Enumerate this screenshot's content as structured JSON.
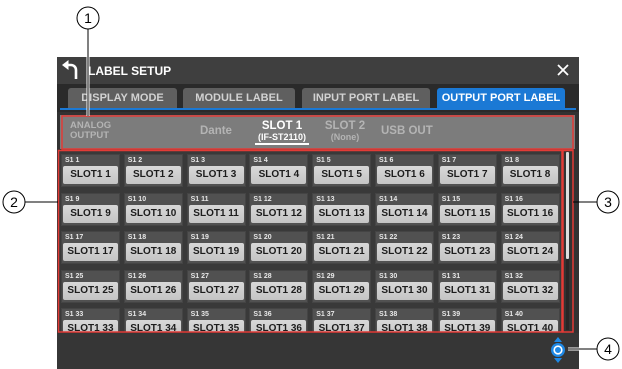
{
  "app": {
    "title": "LABEL SETUP"
  },
  "icons": {
    "back": "back-arrow-icon",
    "close": "close-icon",
    "encoder": "encoder-knob-icon"
  },
  "tabs": [
    {
      "label": "DISPLAY MODE",
      "active": false
    },
    {
      "label": "MODULE LABEL",
      "active": false
    },
    {
      "label": "INPUT PORT LABEL",
      "active": false
    },
    {
      "label": "OUTPUT PORT LABEL",
      "active": true
    }
  ],
  "subtabs": [
    {
      "label": "ANALOG OUTPUT",
      "sub": "",
      "active": false
    },
    {
      "label": "Dante",
      "sub": "",
      "active": false
    },
    {
      "label": "SLOT 1",
      "sub": "(IF-ST2110)",
      "active": true
    },
    {
      "label": "SLOT 2",
      "sub": "(None)",
      "active": false
    },
    {
      "label": "USB OUT",
      "sub": "",
      "active": false
    }
  ],
  "grid": {
    "cells": [
      {
        "port": "S1 1",
        "label": "SLOT1 1"
      },
      {
        "port": "S1 2",
        "label": "SLOT1 2"
      },
      {
        "port": "S1 3",
        "label": "SLOT1 3"
      },
      {
        "port": "S1 4",
        "label": "SLOT1 4"
      },
      {
        "port": "S1 5",
        "label": "SLOT1 5"
      },
      {
        "port": "S1 6",
        "label": "SLOT1 6"
      },
      {
        "port": "S1 7",
        "label": "SLOT1 7"
      },
      {
        "port": "S1 8",
        "label": "SLOT1 8"
      },
      {
        "port": "S1 9",
        "label": "SLOT1 9"
      },
      {
        "port": "S1 10",
        "label": "SLOT1 10"
      },
      {
        "port": "S1 11",
        "label": "SLOT1 11"
      },
      {
        "port": "S1 12",
        "label": "SLOT1 12"
      },
      {
        "port": "S1 13",
        "label": "SLOT1 13"
      },
      {
        "port": "S1 14",
        "label": "SLOT1 14"
      },
      {
        "port": "S1 15",
        "label": "SLOT1 15"
      },
      {
        "port": "S1 16",
        "label": "SLOT1 16"
      },
      {
        "port": "S1 17",
        "label": "SLOT1 17"
      },
      {
        "port": "S1 18",
        "label": "SLOT1 18"
      },
      {
        "port": "S1 19",
        "label": "SLOT1 19"
      },
      {
        "port": "S1 20",
        "label": "SLOT1 20"
      },
      {
        "port": "S1 21",
        "label": "SLOT1 21"
      },
      {
        "port": "S1 22",
        "label": "SLOT1 22"
      },
      {
        "port": "S1 23",
        "label": "SLOT1 23"
      },
      {
        "port": "S1 24",
        "label": "SLOT1 24"
      },
      {
        "port": "S1 25",
        "label": "SLOT1 25"
      },
      {
        "port": "S1 26",
        "label": "SLOT1 26"
      },
      {
        "port": "S1 27",
        "label": "SLOT1 27"
      },
      {
        "port": "S1 28",
        "label": "SLOT1 28"
      },
      {
        "port": "S1 29",
        "label": "SLOT1 29"
      },
      {
        "port": "S1 30",
        "label": "SLOT1 30"
      },
      {
        "port": "S1 31",
        "label": "SLOT1 31"
      },
      {
        "port": "S1 32",
        "label": "SLOT1 32"
      },
      {
        "port": "S1 33",
        "label": "SLOT1 33"
      },
      {
        "port": "S1 34",
        "label": "SLOT1 34"
      },
      {
        "port": "S1 35",
        "label": "SLOT1 35"
      },
      {
        "port": "S1 36",
        "label": "SLOT1 36"
      },
      {
        "port": "S1 37",
        "label": "SLOT1 37"
      },
      {
        "port": "S1 38",
        "label": "SLOT1 38"
      },
      {
        "port": "S1 39",
        "label": "SLOT1 39"
      },
      {
        "port": "S1 40",
        "label": "SLOT1 40"
      }
    ]
  },
  "scrollbar": {
    "position": 0,
    "visible_fraction": 0.6
  },
  "callouts": [
    "1",
    "2",
    "3",
    "4"
  ],
  "colors": {
    "accent": "#1b79d5",
    "annotation_red": "#e23b36",
    "encoder_blue": "#1e88e5"
  }
}
